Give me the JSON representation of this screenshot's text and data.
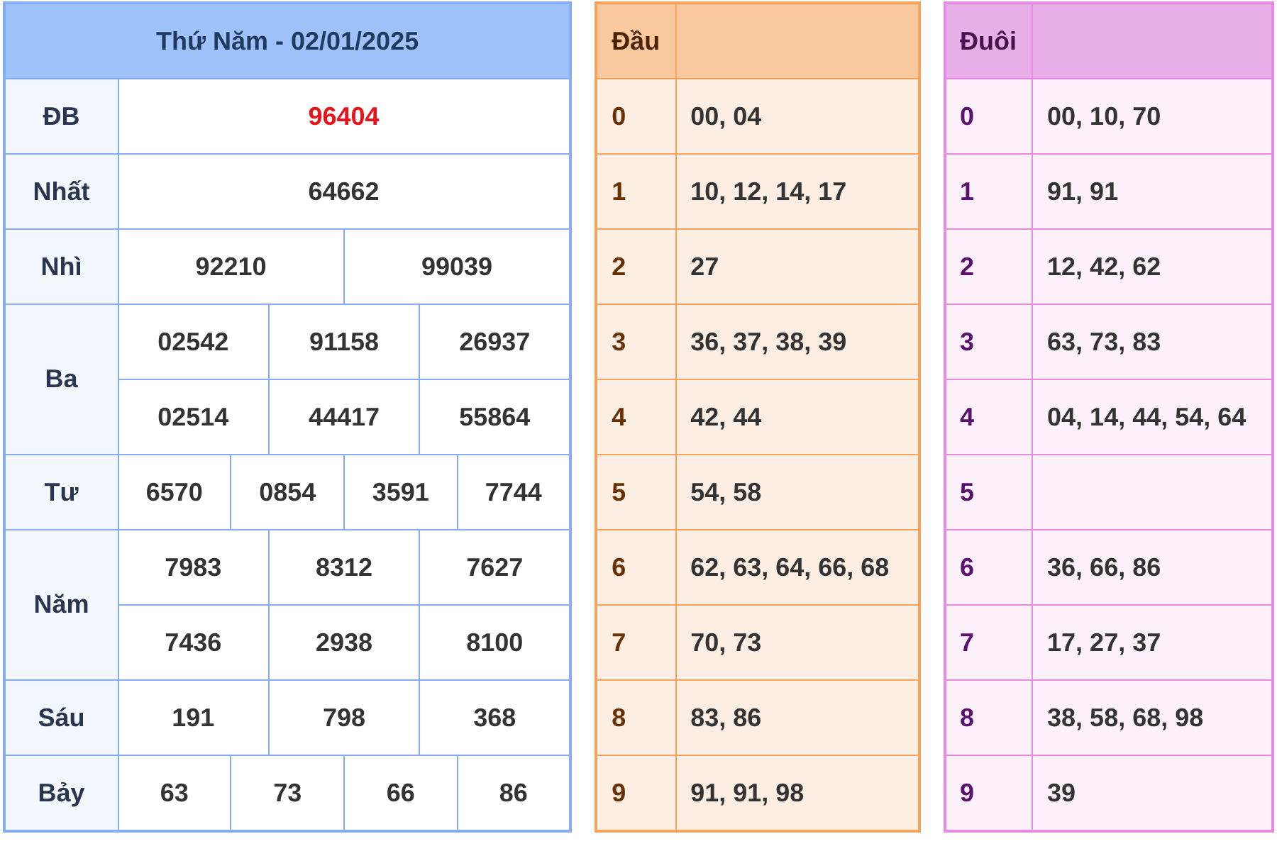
{
  "results": {
    "heading": "Thứ Năm - 02/01/2025",
    "prizes": [
      {
        "label": "ĐB",
        "kind": "special",
        "rows": [
          [
            "96404"
          ]
        ]
      },
      {
        "label": "Nhất",
        "kind": "normal",
        "rows": [
          [
            "64662"
          ]
        ]
      },
      {
        "label": "Nhì",
        "kind": "normal",
        "rows": [
          [
            "92210",
            "99039"
          ]
        ]
      },
      {
        "label": "Ba",
        "kind": "normal",
        "rows": [
          [
            "02542",
            "91158",
            "26937"
          ],
          [
            "02514",
            "44417",
            "55864"
          ]
        ]
      },
      {
        "label": "Tư",
        "kind": "normal",
        "rows": [
          [
            "6570",
            "0854",
            "3591",
            "7744"
          ]
        ]
      },
      {
        "label": "Năm",
        "kind": "normal",
        "rows": [
          [
            "7983",
            "8312",
            "7627"
          ],
          [
            "7436",
            "2938",
            "8100"
          ]
        ]
      },
      {
        "label": "Sáu",
        "kind": "normal",
        "rows": [
          [
            "191",
            "798",
            "368"
          ]
        ]
      },
      {
        "label": "Bảy",
        "kind": "normal",
        "rows": [
          [
            "63",
            "73",
            "66",
            "86"
          ]
        ]
      }
    ]
  },
  "dau": {
    "heading": "Đầu",
    "rows": [
      {
        "digit": "0",
        "numbers": "00, 04"
      },
      {
        "digit": "1",
        "numbers": "10, 12, 14, 17"
      },
      {
        "digit": "2",
        "numbers": "27"
      },
      {
        "digit": "3",
        "numbers": "36, 37, 38, 39"
      },
      {
        "digit": "4",
        "numbers": "42, 44"
      },
      {
        "digit": "5",
        "numbers": "54, 58"
      },
      {
        "digit": "6",
        "numbers": "62, 63, 64, 66, 68"
      },
      {
        "digit": "7",
        "numbers": "70, 73"
      },
      {
        "digit": "8",
        "numbers": "83, 86"
      },
      {
        "digit": "9",
        "numbers": "91, 91, 98"
      }
    ]
  },
  "duoi": {
    "heading": "Đuôi",
    "rows": [
      {
        "digit": "0",
        "numbers": "00, 10, 70"
      },
      {
        "digit": "1",
        "numbers": "91, 91"
      },
      {
        "digit": "2",
        "numbers": "12, 42, 62"
      },
      {
        "digit": "3",
        "numbers": "63, 73, 83"
      },
      {
        "digit": "4",
        "numbers": "04, 14, 44, 54, 64"
      },
      {
        "digit": "5"
      },
      {
        "digit": "6",
        "numbers": "36, 66, 86"
      },
      {
        "digit": "7",
        "numbers": "17, 27, 37"
      },
      {
        "digit": "8",
        "numbers": "38, 58, 68, 98"
      },
      {
        "digit": "9",
        "numbers": "39"
      }
    ]
  }
}
